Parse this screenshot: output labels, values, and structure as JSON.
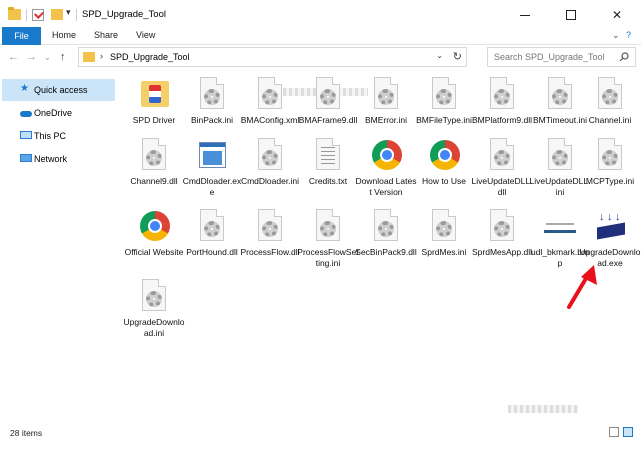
{
  "window": {
    "title": "SPD_Upgrade_Tool",
    "dropdown_glyph": "▾"
  },
  "ribbon": {
    "tabs": [
      "File",
      "Home",
      "Share",
      "View"
    ]
  },
  "address": {
    "path": "SPD_Upgrade_Tool",
    "search_placeholder": "Search SPD_Upgrade_Tool"
  },
  "navpane": {
    "items": [
      {
        "label": "Quick access",
        "icon": "star-icon",
        "selected": true
      },
      {
        "label": "OneDrive",
        "icon": "cloud-icon"
      },
      {
        "label": "This PC",
        "icon": "computer-icon"
      },
      {
        "label": "Network",
        "icon": "network-icon"
      }
    ]
  },
  "files": [
    {
      "label": "SPD Driver",
      "icon": "spd-folder-icon"
    },
    {
      "label": "BinPack.ini",
      "icon": "ini-settings-icon"
    },
    {
      "label": "BMAConfig.xml",
      "icon": "ini-settings-icon"
    },
    {
      "label": "BMAFrame9.dll",
      "icon": "dll-settings-icon"
    },
    {
      "label": "BMError.ini",
      "icon": "ini-settings-icon"
    },
    {
      "label": "BMFileType.ini",
      "icon": "ini-settings-icon"
    },
    {
      "label": "BMPlatform9.dll",
      "icon": "dll-settings-icon"
    },
    {
      "label": "BMTimeout.ini",
      "icon": "ini-settings-icon"
    },
    {
      "label": "Channel.ini",
      "icon": "ini-settings-icon"
    },
    {
      "label": "Channel9.dll",
      "icon": "dll-settings-icon"
    },
    {
      "label": "CmdDloader.exe",
      "icon": "exe-window-icon"
    },
    {
      "label": "CmdDloader.ini",
      "icon": "ini-settings-icon"
    },
    {
      "label": "Credits.txt",
      "icon": "text-file-icon"
    },
    {
      "label": "Download Latest Version",
      "icon": "chrome-icon"
    },
    {
      "label": "How to Use",
      "icon": "chrome-icon"
    },
    {
      "label": "LiveUpdateDLL.dll",
      "icon": "dll-settings-icon"
    },
    {
      "label": "LiveUpdateDLL.ini",
      "icon": "ini-settings-icon"
    },
    {
      "label": "MCPType.ini",
      "icon": "ini-settings-icon"
    },
    {
      "label": "Official Website",
      "icon": "chrome-icon"
    },
    {
      "label": "PortHound.dll",
      "icon": "dll-settings-icon"
    },
    {
      "label": "ProcessFlow.dll",
      "icon": "dll-settings-icon"
    },
    {
      "label": "ProcessFlowSetting.ini",
      "icon": "ini-settings-icon"
    },
    {
      "label": "SecBinPack9.dll",
      "icon": "dll-settings-icon"
    },
    {
      "label": "SprdMes.ini",
      "icon": "ini-settings-icon"
    },
    {
      "label": "SprdMesApp.dll",
      "icon": "dll-settings-icon"
    },
    {
      "label": "udl_bkmark.bmp",
      "icon": "bitmap-icon"
    },
    {
      "label": "UpgradeDownload.exe",
      "icon": "upgrade-download-icon"
    },
    {
      "label": "UpgradeDownload.ini",
      "icon": "ini-settings-icon"
    }
  ],
  "status": {
    "item_count": "28 items"
  },
  "colors": {
    "accent": "#1979ca",
    "selection": "#cce4f7",
    "annotation_arrow": "#e8101a"
  }
}
